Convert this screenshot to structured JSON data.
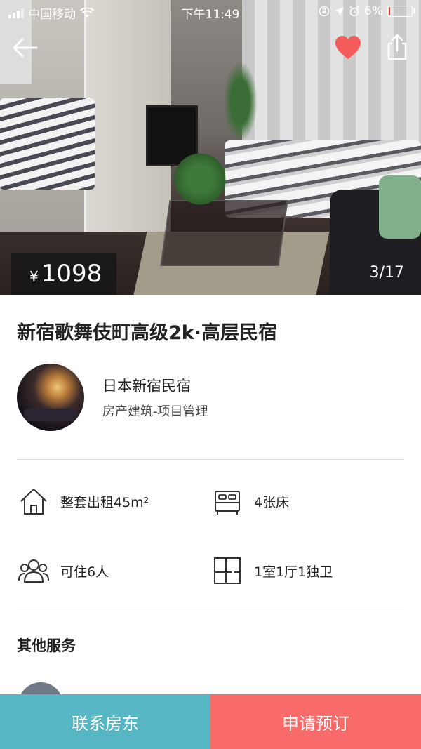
{
  "status_bar": {
    "carrier": "中国移动",
    "time": "下午11:49",
    "battery_percent": "6%",
    "battery_level": 0.06,
    "battery_color": "#e53935"
  },
  "icons": {
    "back": "arrow-left-icon",
    "favorite": "heart-icon",
    "share": "share-icon"
  },
  "gallery": {
    "currency": "¥",
    "price": "1098",
    "counter": "3/17"
  },
  "listing": {
    "title": "新宿歌舞伎町高级2k·高层民宿"
  },
  "host": {
    "name": "日本新宿民宿",
    "role": "房产建筑-项目管理"
  },
  "features": [
    {
      "icon": "house-icon",
      "label": "整套出租45m²"
    },
    {
      "icon": "bed-icon",
      "label": "4张床"
    },
    {
      "icon": "people-icon",
      "label": "可住6人"
    },
    {
      "icon": "floorplan-icon",
      "label": "1室1厅1独卫"
    }
  ],
  "services": {
    "title": "其他服务"
  },
  "actions": {
    "contact_label": "联系房东",
    "book_label": "申请预订"
  },
  "colors": {
    "contact_button": "#57b6c4",
    "book_button": "#f96a6a",
    "favorite": "#f45b5b"
  }
}
